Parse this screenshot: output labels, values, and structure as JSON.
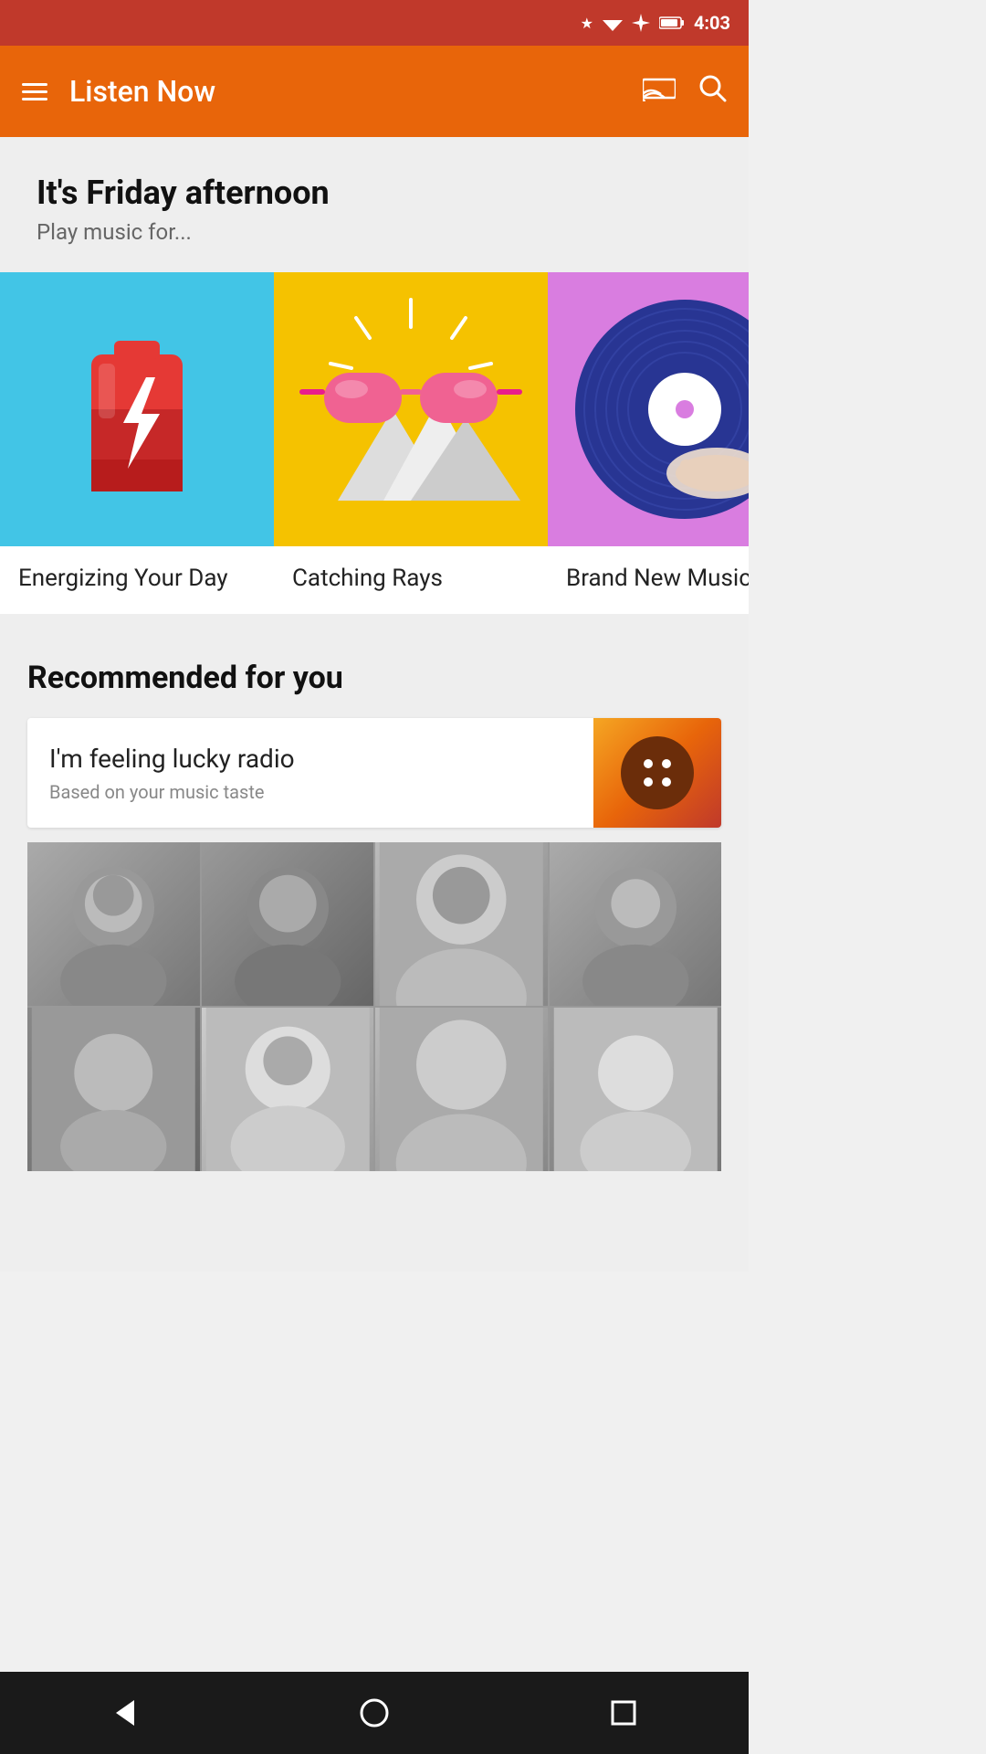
{
  "statusBar": {
    "time": "4:03",
    "icons": [
      "star",
      "wifi",
      "airplane",
      "battery"
    ]
  },
  "appBar": {
    "title": "Listen Now",
    "castLabel": "cast",
    "searchLabel": "search"
  },
  "greeting": {
    "title": "It's Friday afternoon",
    "subtitle": "Play music for..."
  },
  "playlists": [
    {
      "id": "energize",
      "label": "Energizing Your Day",
      "colorClass": "card-energize",
      "bg": "#42c5e6"
    },
    {
      "id": "catching",
      "label": "Catching Rays",
      "colorClass": "card-catching",
      "bg": "#f5c200"
    },
    {
      "id": "brand",
      "label": "Brand New Music",
      "colorClass": "card-brand",
      "bg": "#d97de0"
    }
  ],
  "recommended": {
    "sectionTitle": "Recommended for you",
    "luckyRadio": {
      "title": "I'm feeling lucky radio",
      "subtitle": "Based on your music taste"
    }
  },
  "navbar": {
    "backLabel": "back",
    "homeLabel": "home",
    "recentLabel": "recent"
  }
}
